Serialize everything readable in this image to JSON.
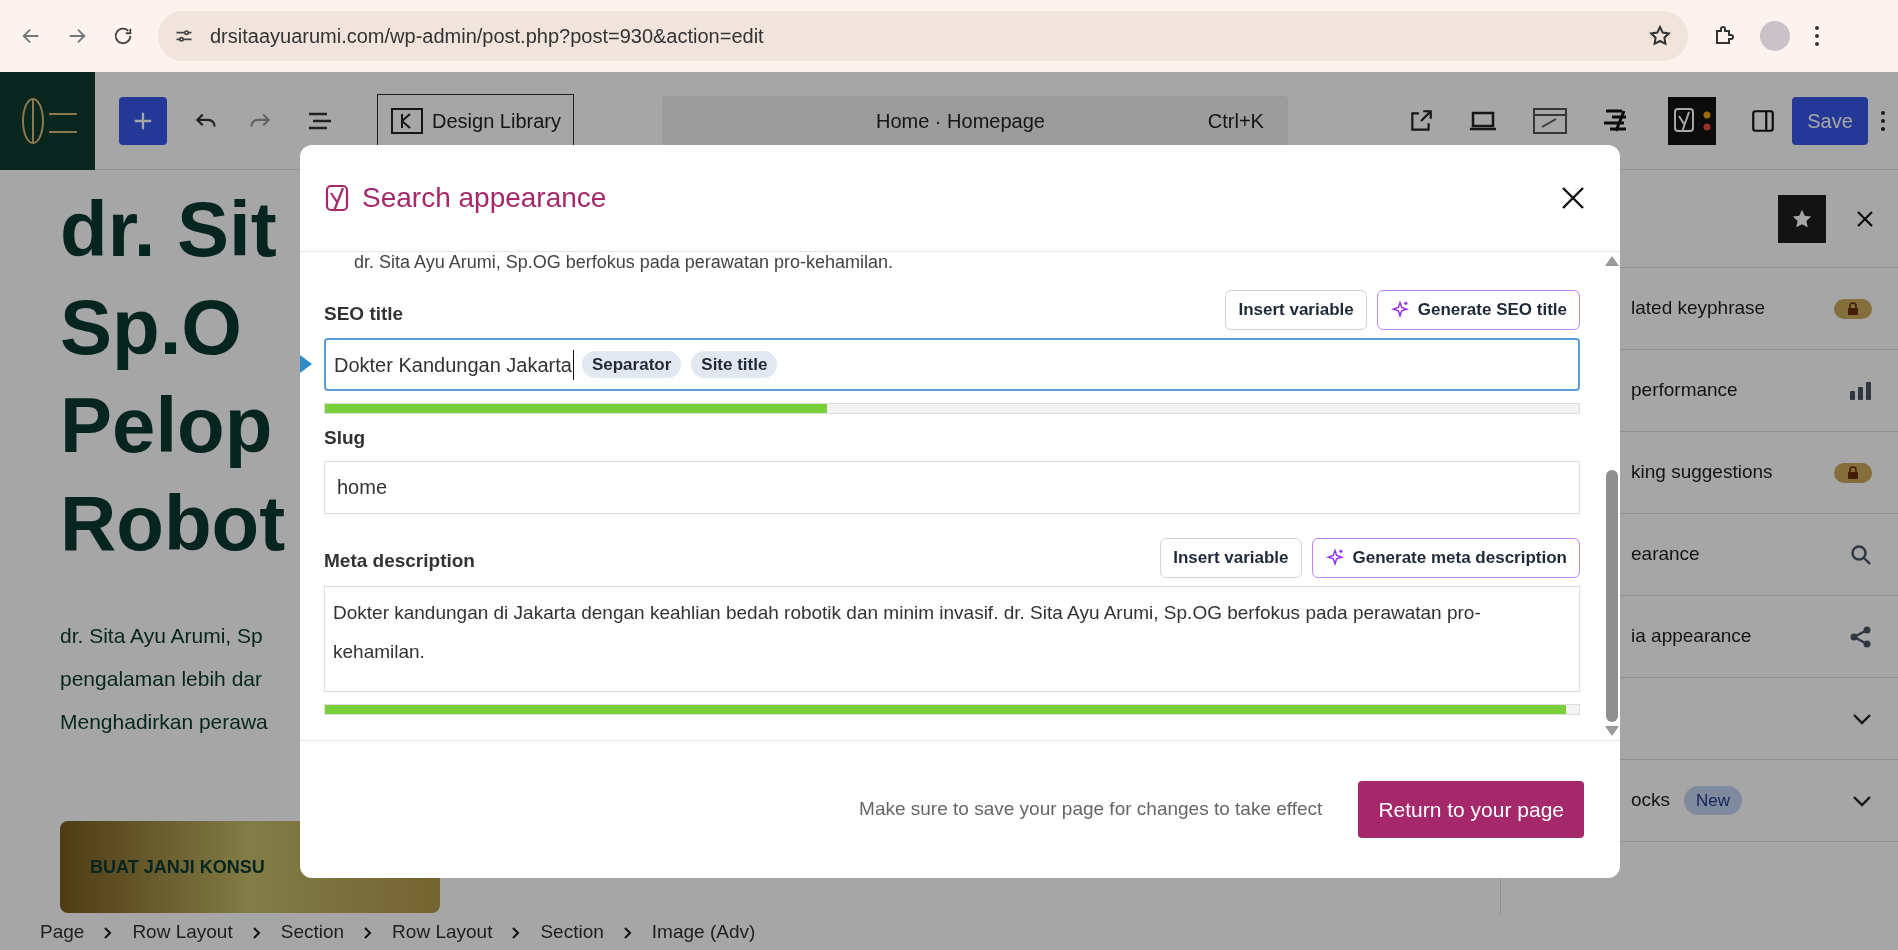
{
  "browser": {
    "url": "drsitaayuarumi.com/wp-admin/post.php?post=930&action=edit"
  },
  "toolbar": {
    "design_library": "Design Library",
    "command_title": "Home · Homepage",
    "command_shortcut": "Ctrl+K",
    "save": "Save"
  },
  "canvas": {
    "heading_lines": [
      "dr. Sit",
      "Sp.O",
      "Pelop",
      "Robot"
    ],
    "paragraph_lines": [
      "dr. Sita Ayu Arumi, Sp",
      "pengalaman lebih dar",
      "Menghadirkan perawa"
    ],
    "cta": "BUAT JANJI KONSU"
  },
  "sidebar": {
    "items": [
      {
        "label": "lated keyphrase",
        "kind": "lock"
      },
      {
        "label": "performance",
        "kind": "bars"
      },
      {
        "label": "king suggestions",
        "kind": "lock"
      },
      {
        "label": "earance",
        "kind": "search"
      },
      {
        "label": "ia appearance",
        "kind": "share"
      },
      {
        "kind": "chevron"
      },
      {
        "label": "ocks",
        "kind": "chevron",
        "badge": "New"
      }
    ]
  },
  "modal": {
    "title": "Search appearance",
    "scrolled_text": "dr. Sita Ayu Arumi, Sp.OG berfokus pada perawatan pro-kehamilan.",
    "seo_title": {
      "label": "SEO title",
      "insert_variable": "Insert variable",
      "generate": "Generate SEO title",
      "value": "Dokter Kandungan Jakarta",
      "tags": [
        "Separator",
        "Site title"
      ],
      "level": 0.4
    },
    "slug": {
      "label": "Slug",
      "value": "home"
    },
    "meta": {
      "label": "Meta description",
      "insert_variable": "Insert variable",
      "generate": "Generate meta description",
      "value": "Dokter kandungan di Jakarta dengan keahlian bedah robotik dan minim invasif. dr. Sita Ayu Arumi, Sp.OG berfokus pada perawatan pro-kehamilan.",
      "level": 0.99
    },
    "note": "Make sure to save your page for changes to take effect",
    "return_button": "Return to your page"
  },
  "breadcrumbs": [
    "Page",
    "Row Layout",
    "Section",
    "Row Layout",
    "Section",
    "Image (Adv)"
  ]
}
